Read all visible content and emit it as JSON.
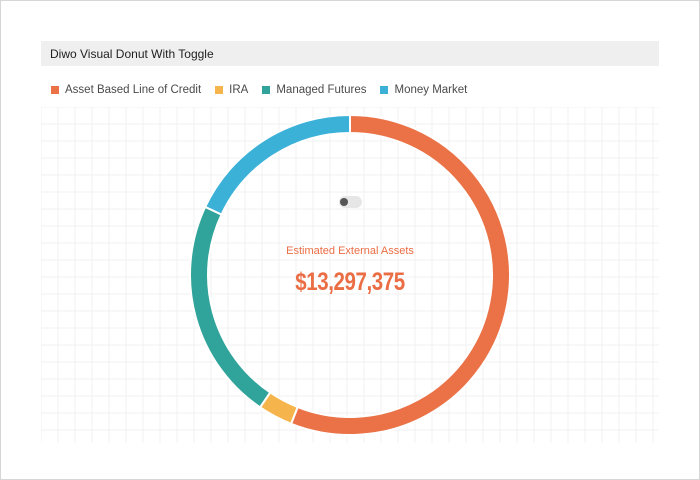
{
  "title": "Diwo Visual Donut With Toggle",
  "center": {
    "label": "Estimated External Assets",
    "value": "$13,297,375"
  },
  "colors": {
    "accent": "#ea6d44"
  },
  "toggle": {
    "state": "off"
  },
  "chart_data": {
    "type": "pie",
    "variant": "donut",
    "legend_position": "top-left",
    "grid": true,
    "series": [
      {
        "name": "Asset Based Line of Credit",
        "value": 56.0,
        "color": "#ea7246"
      },
      {
        "name": "IRA",
        "value": 3.5,
        "color": "#f6b54c"
      },
      {
        "name": "Managed Futures",
        "value": 22.5,
        "color": "#30a49a"
      },
      {
        "name": "Money Market",
        "value": 18.0,
        "color": "#3bb1d8"
      }
    ]
  }
}
